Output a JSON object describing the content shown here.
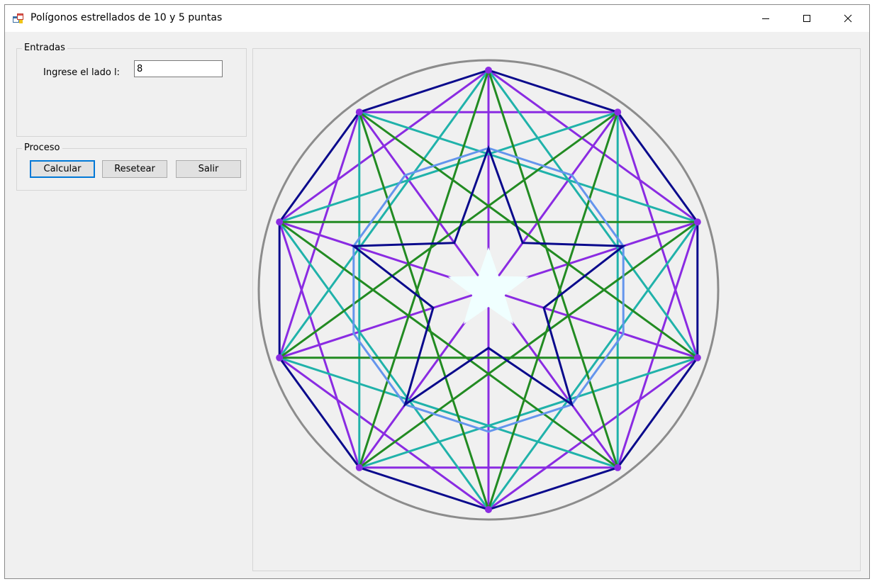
{
  "window": {
    "title": "Polígonos estrellados de 10 y 5 puntas",
    "app_icon": "windows-forms-app-icon",
    "controls": {
      "minimize": "minimize-icon",
      "maximize": "maximize-icon",
      "close": "close-icon"
    }
  },
  "entradas": {
    "legend": "Entradas",
    "lado_label": "Ingrese el lado l:",
    "lado_value": "8"
  },
  "proceso": {
    "legend": "Proceso",
    "calcular_label": "Calcular",
    "resetear_label": "Resetear",
    "salir_label": "Salir"
  },
  "drawing": {
    "outer_polygon_sides": 10,
    "inner_polygon_sides": 10,
    "star_points": 5,
    "colors": {
      "circle": "#8c8c8c",
      "decagon": "#0a0a8c",
      "star_10_3": "#20b2aa",
      "pentagram_10_4": "#228b22",
      "chords": "#8a2be2",
      "inner_decagon": "#6495ed",
      "inner_star": "#0a0a8c",
      "center_star": "#f0ffff"
    }
  }
}
